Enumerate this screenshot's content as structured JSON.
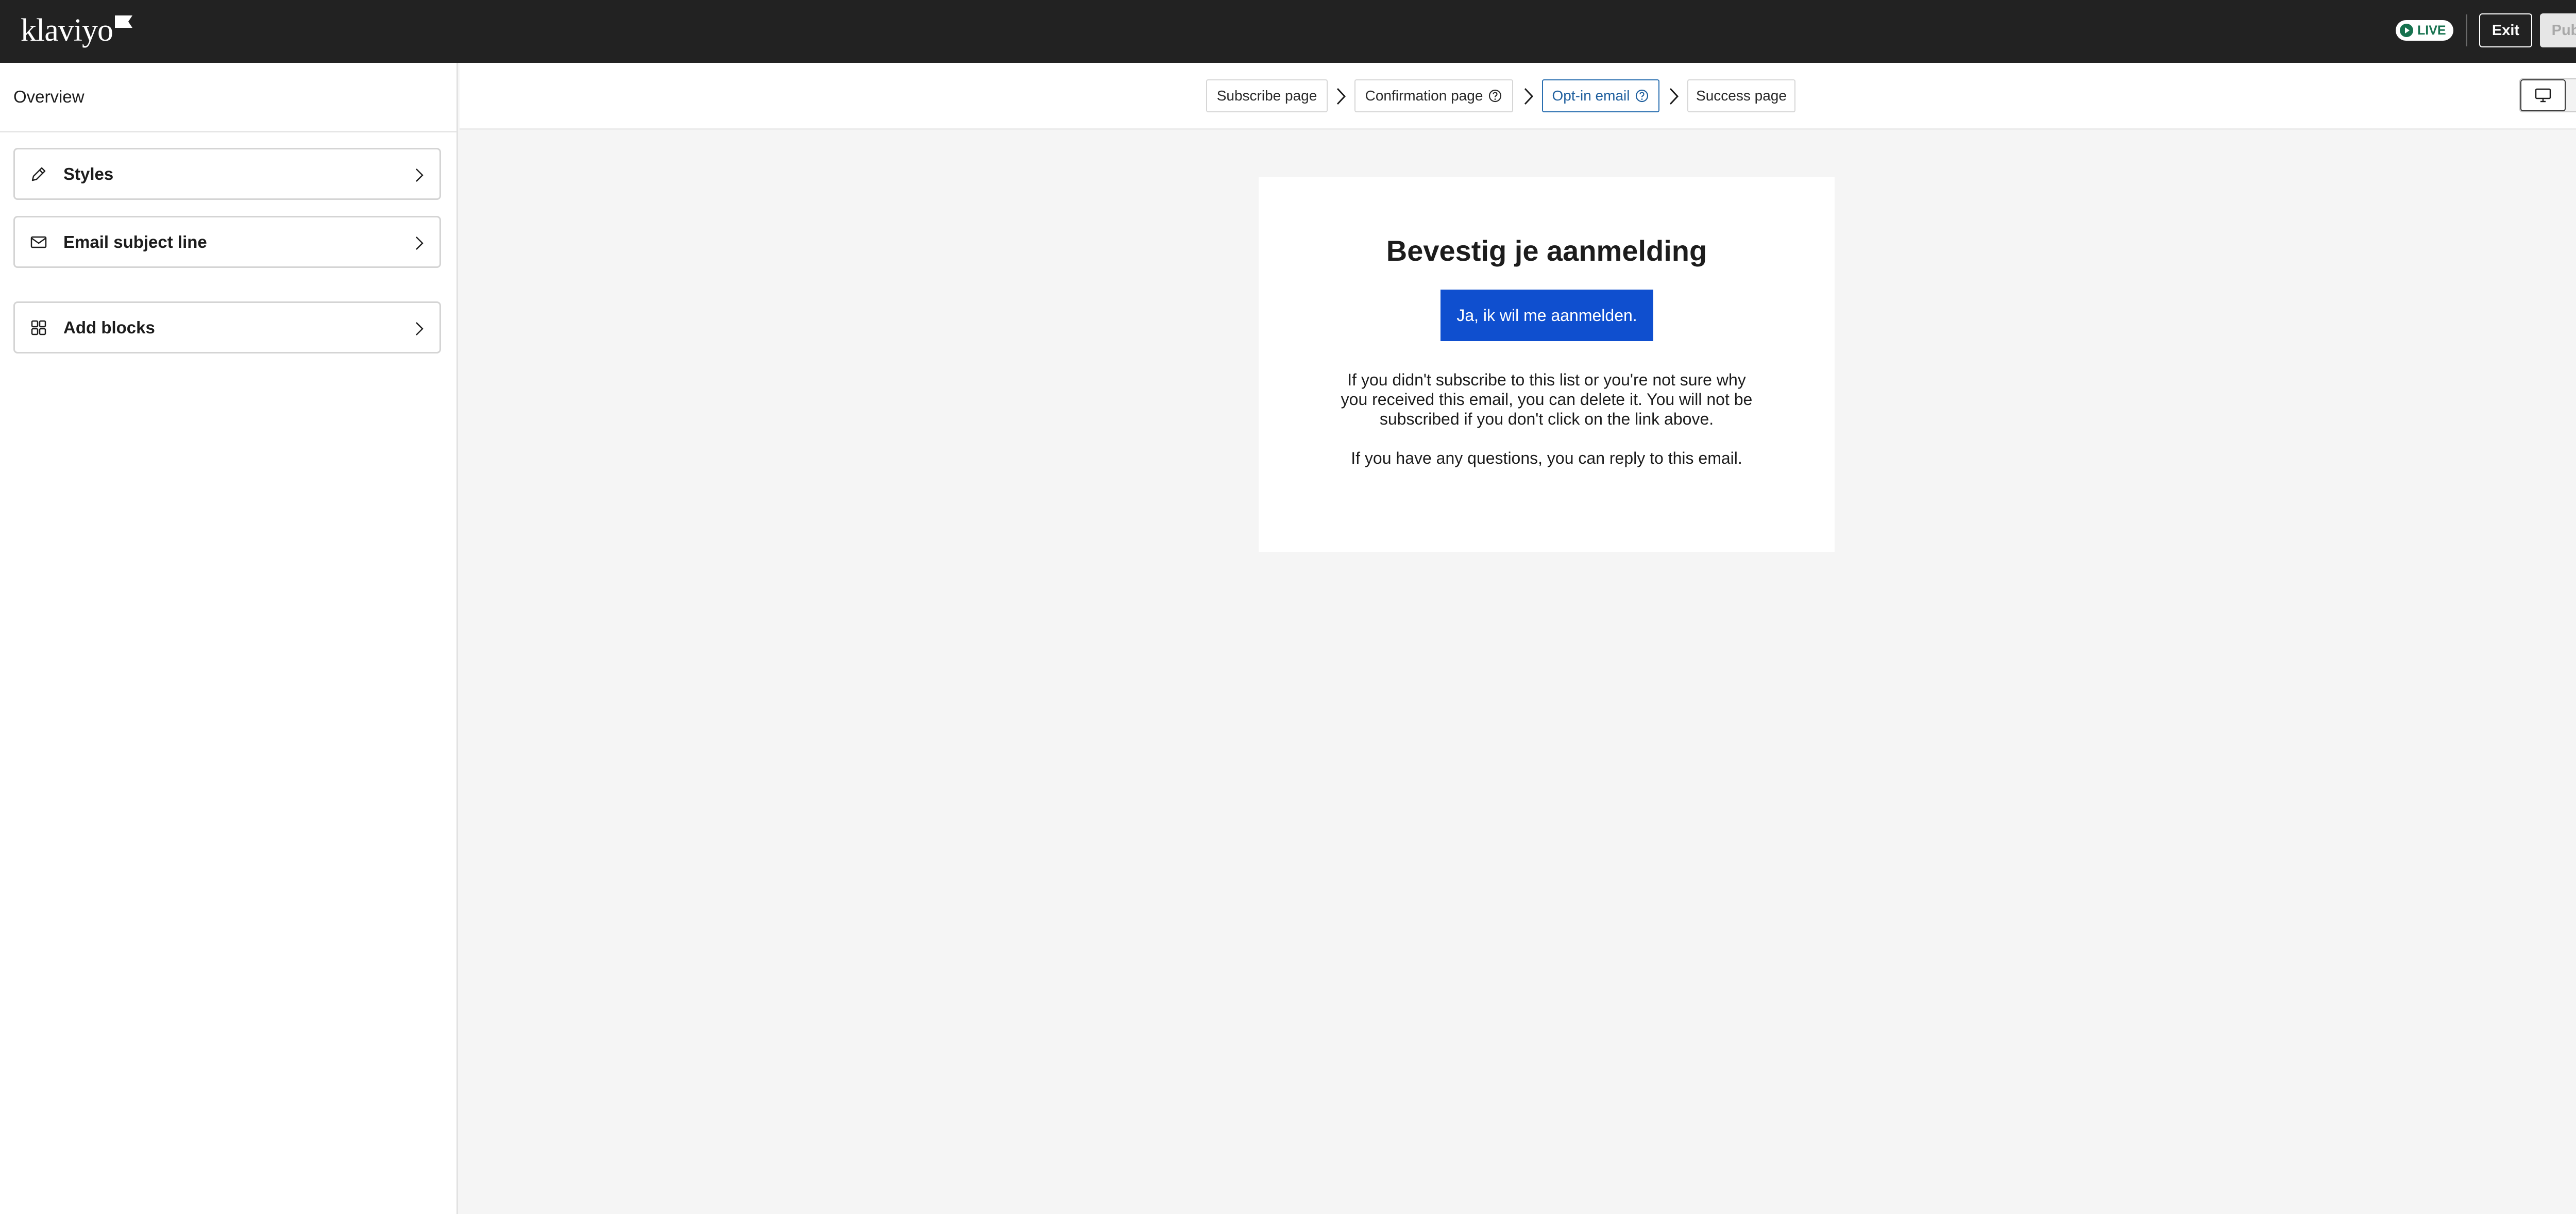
{
  "header": {
    "logo_text": "klaviyo",
    "live_badge": "LIVE",
    "exit_label": "Exit",
    "publish_label": "Publish"
  },
  "sidebar": {
    "title": "Overview",
    "items": [
      {
        "label": "Styles",
        "icon": "brush-icon"
      },
      {
        "label": "Email subject line",
        "icon": "envelope-icon"
      },
      {
        "label": "Add blocks",
        "icon": "grid-icon"
      }
    ]
  },
  "steps": [
    {
      "label": "Subscribe page",
      "active": false,
      "help": false
    },
    {
      "label": "Confirmation page",
      "active": false,
      "help": true
    },
    {
      "label": "Opt-in email",
      "active": true,
      "help": true
    },
    {
      "label": "Success page",
      "active": false,
      "help": false
    }
  ],
  "view_toggle": {
    "options": [
      "desktop-icon",
      "mobile-icon"
    ],
    "selected": "desktop-icon"
  },
  "email": {
    "title": "Bevestig je aanmelding",
    "cta_label": "Ja, ik wil me aanmelden.",
    "body_1": "If you didn't subscribe to this list or you're not sure why you received this email, you can delete it. You will not be subscribed if you don't click on the link above.",
    "body_2": "If you have any questions, you can reply to this email."
  },
  "colors": {
    "topbar": "#222222",
    "live_green": "#17724f",
    "active_step": "#1f5f9e",
    "cta_blue": "#0f4fcf"
  }
}
